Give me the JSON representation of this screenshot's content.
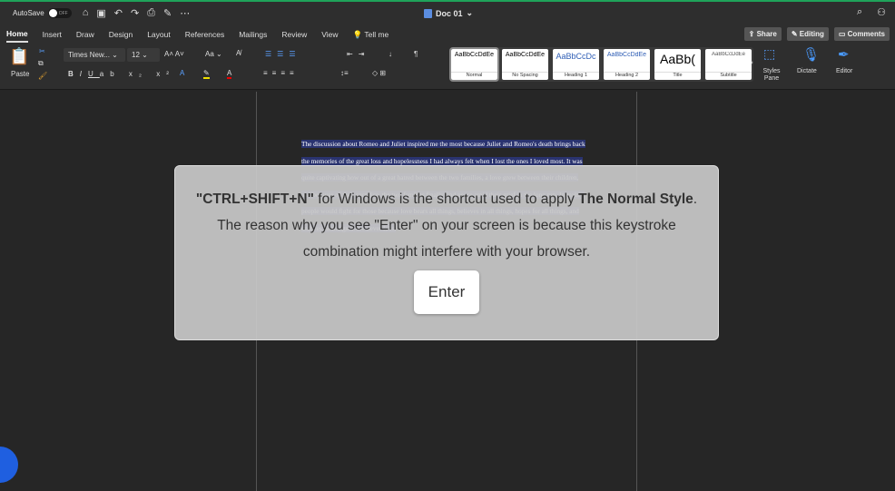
{
  "titlebar": {
    "autosave": "AutoSave",
    "toggle": "OFF",
    "doc_title": "Doc 01"
  },
  "tabs": [
    "Home",
    "Insert",
    "Draw",
    "Design",
    "Layout",
    "References",
    "Mailings",
    "Review",
    "View",
    "Tell me"
  ],
  "tab_buttons": {
    "share": "Share",
    "editing": "Editing",
    "comments": "Comments"
  },
  "ribbon": {
    "paste": "Paste",
    "font": "Times New...",
    "size": "12",
    "case": "Aa",
    "styles_pane": "Styles Pane",
    "dictate": "Dictate",
    "editor": "Editor"
  },
  "styles": [
    {
      "preview": "AaBbCcDdEe",
      "name": "Normal"
    },
    {
      "preview": "AaBbCcDdEe",
      "name": "No Spacing"
    },
    {
      "preview": "AaBbCcDc",
      "name": "Heading 1"
    },
    {
      "preview": "AaBbCcDdEe",
      "name": "Heading 2"
    },
    {
      "preview": "AaBb(",
      "name": "Title"
    },
    {
      "preview": "AaBbCcDdEe",
      "name": "Subtitle"
    }
  ],
  "document": {
    "text": "The discussion about Romeo and Juliet inspired me the most because Juliet and Romeo's death brings back the memories of the great loss and hopelessness I had always felt when I lost the ones I loved most. It was quite captivating how out of a great hatred between the two families, a love grew between their children, and because of their sacrifice, the two families finally find peace amid their grief in the long run. In reality, people would fight for those because love bears all things, believes in all things, hopes for all things, and endures all things. Love never fails."
  },
  "overlay": {
    "keys": "\"CTRL+SHIFT+N\"",
    "t1": " for Windows is the shortcut used to apply ",
    "style": "The Normal Style",
    "t2": ". The reason why you see \"Enter\" on your screen is because this keystroke combination might interfere with your browser.",
    "button": "Enter"
  }
}
